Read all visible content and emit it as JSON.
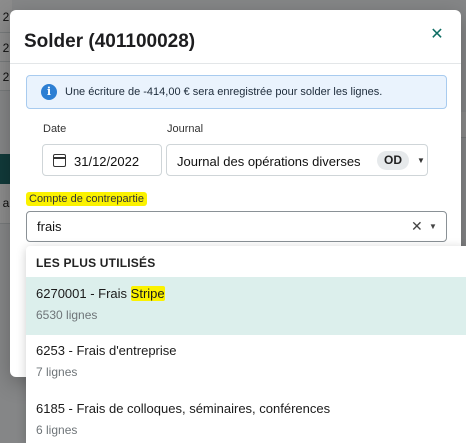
{
  "background": {
    "digits": [
      "2",
      "2",
      "2",
      "a"
    ]
  },
  "modal": {
    "title": "Solder (401100028)",
    "close_icon": "close-icon",
    "info": {
      "icon": "info-icon",
      "text": "Une écriture de -414,00 € sera enregistrée pour solder les lignes."
    },
    "date": {
      "label": "Date",
      "value": "31/12/2022",
      "icon": "calendar-icon"
    },
    "journal": {
      "label": "Journal",
      "value": "Journal des opérations diverses",
      "badge": "OD"
    },
    "compte": {
      "label": "Compte de contrepartie",
      "value": "frais"
    }
  },
  "dropdown": {
    "header": "LES PLUS UTILISÉS",
    "items": [
      {
        "title_prefix": "6270001 - Frais ",
        "title_highlight": "Stripe",
        "sub": "6530 lignes",
        "active": true
      },
      {
        "title": "6253 - Frais d'entreprise",
        "sub": "7 lignes"
      },
      {
        "title": "6185 - Frais de colloques, séminaires, conférences",
        "sub": "6 lignes"
      }
    ]
  },
  "colors": {
    "accent": "#0f6e64",
    "highlight": "#fbf200",
    "info_bg": "#eaf3fd",
    "active_item_bg": "#dcefec"
  }
}
